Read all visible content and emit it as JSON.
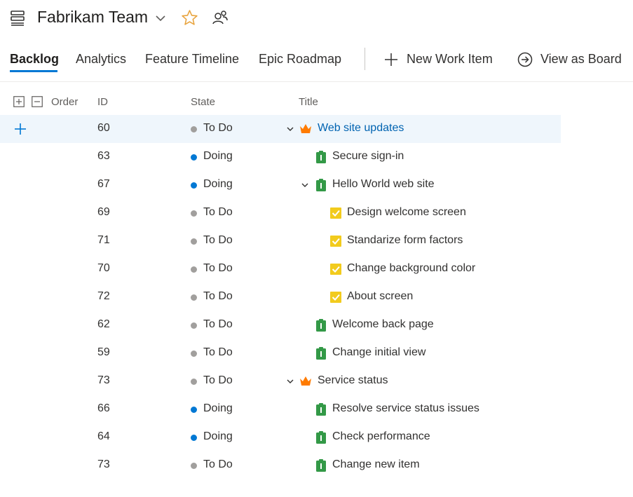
{
  "header": {
    "team_name": "Fabrikam Team"
  },
  "tabs": [
    {
      "label": "Backlog",
      "selected": true
    },
    {
      "label": "Analytics",
      "selected": false
    },
    {
      "label": "Feature Timeline",
      "selected": false
    },
    {
      "label": "Epic Roadmap",
      "selected": false
    }
  ],
  "commands": {
    "new_work_item": "New Work Item",
    "view_as_board": "View as Board"
  },
  "columns": {
    "order": "Order",
    "id": "ID",
    "state": "State",
    "title": "Title"
  },
  "colors": {
    "accent": "#0078d4",
    "todo": "#a19f9d",
    "doing": "#0078d4",
    "epic": "#ff7b00",
    "feature": "#339947",
    "task": "#f2cb1d"
  },
  "rows": [
    {
      "id": "60",
      "state": "To Do",
      "type": "epic",
      "title": "Web site updates",
      "level": 0,
      "expanded": true,
      "selected": true
    },
    {
      "id": "63",
      "state": "Doing",
      "type": "backlog-item",
      "title": "Secure sign-in",
      "level": 1,
      "expanded": false,
      "selected": false
    },
    {
      "id": "67",
      "state": "Doing",
      "type": "backlog-item",
      "title": "Hello World web site",
      "level": 1,
      "expanded": true,
      "selected": false
    },
    {
      "id": "69",
      "state": "To Do",
      "type": "task",
      "title": "Design welcome screen",
      "level": 2,
      "expanded": false,
      "selected": false
    },
    {
      "id": "71",
      "state": "To Do",
      "type": "task",
      "title": "Standarize form factors",
      "level": 2,
      "expanded": false,
      "selected": false
    },
    {
      "id": "70",
      "state": "To Do",
      "type": "task",
      "title": "Change background color",
      "level": 2,
      "expanded": false,
      "selected": false
    },
    {
      "id": "72",
      "state": "To Do",
      "type": "task",
      "title": "About screen",
      "level": 2,
      "expanded": false,
      "selected": false
    },
    {
      "id": "62",
      "state": "To Do",
      "type": "backlog-item",
      "title": "Welcome back page",
      "level": 1,
      "expanded": false,
      "selected": false
    },
    {
      "id": "59",
      "state": "To Do",
      "type": "backlog-item",
      "title": "Change initial view",
      "level": 1,
      "expanded": false,
      "selected": false
    },
    {
      "id": "73",
      "state": "To Do",
      "type": "epic",
      "title": "Service status",
      "level": 0,
      "expanded": true,
      "selected": false
    },
    {
      "id": "66",
      "state": "Doing",
      "type": "backlog-item",
      "title": "Resolve service status issues",
      "level": 1,
      "expanded": false,
      "selected": false
    },
    {
      "id": "64",
      "state": "Doing",
      "type": "backlog-item",
      "title": "Check performance",
      "level": 1,
      "expanded": false,
      "selected": false
    },
    {
      "id": "73",
      "state": "To Do",
      "type": "backlog-item",
      "title": "Change new item",
      "level": 1,
      "expanded": false,
      "selected": false
    }
  ]
}
